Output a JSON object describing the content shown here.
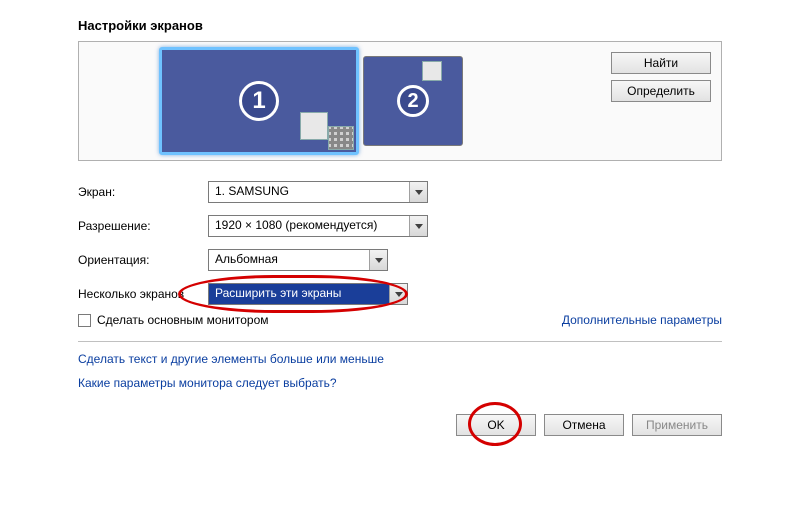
{
  "title": "Настройки экранов",
  "preview": {
    "monitor1_num": "1",
    "monitor2_num": "2",
    "find_btn": "Найти",
    "identify_btn": "Определить"
  },
  "fields": {
    "screen_label": "Экран:",
    "screen_value": "1. SAMSUNG",
    "resolution_label": "Разрешение:",
    "resolution_value": "1920 × 1080 (рекомендуется)",
    "orientation_label": "Ориентация:",
    "orientation_value": "Альбомная",
    "multiscreen_label": "Несколько экранов",
    "multiscreen_value": "Расширить эти экраны"
  },
  "checkbox_label": "Сделать основным монитором",
  "advanced_link": "Дополнительные параметры",
  "help_link1": "Сделать текст и другие элементы больше или меньше",
  "help_link2": "Какие параметры монитора следует выбрать?",
  "buttons": {
    "ok": "OK",
    "cancel": "Отмена",
    "apply": "Применить"
  }
}
